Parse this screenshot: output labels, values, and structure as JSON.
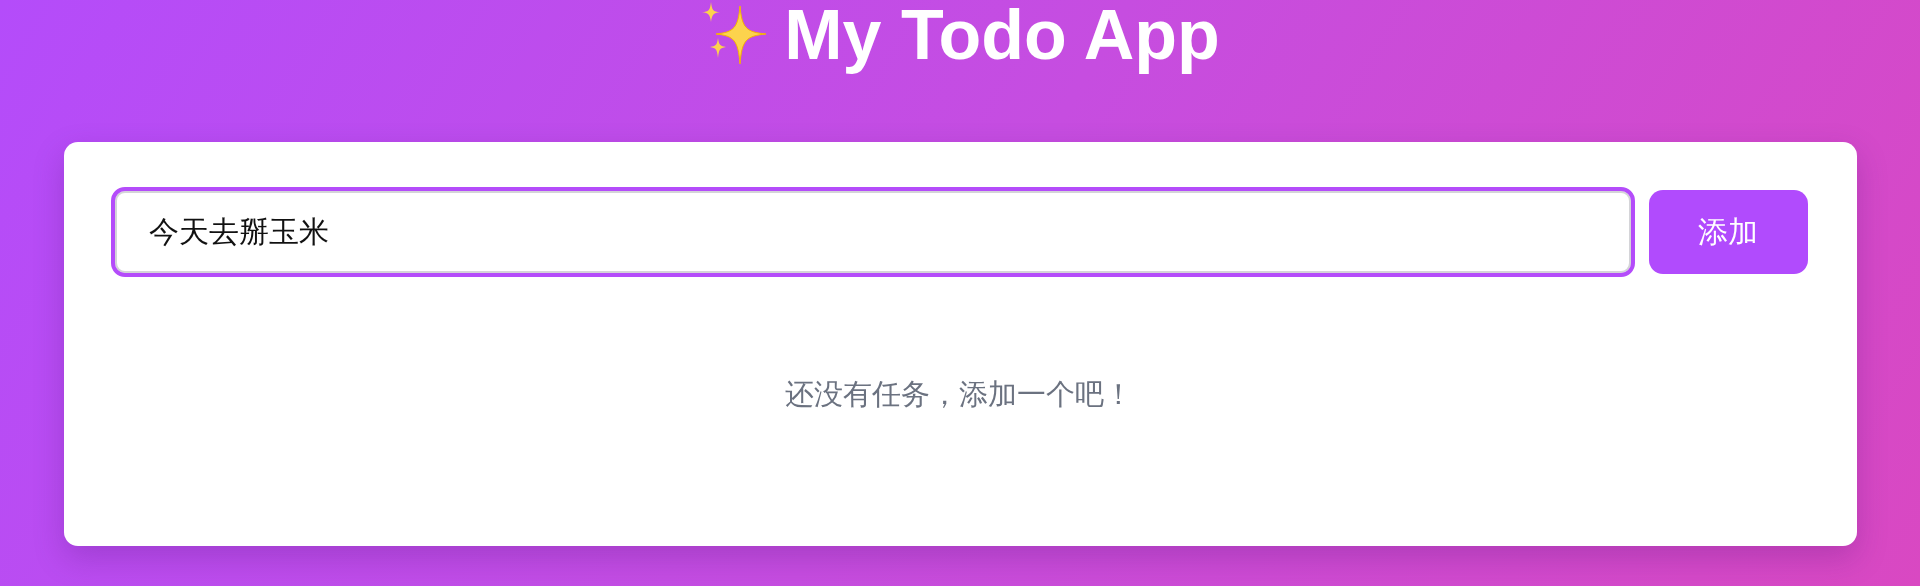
{
  "header": {
    "title": "My Todo App"
  },
  "new_todo": {
    "value": "今天去掰玉米",
    "focused": true
  },
  "add_button": {
    "label": "添加"
  },
  "empty_message": "还没有任务，添加一个吧！"
}
